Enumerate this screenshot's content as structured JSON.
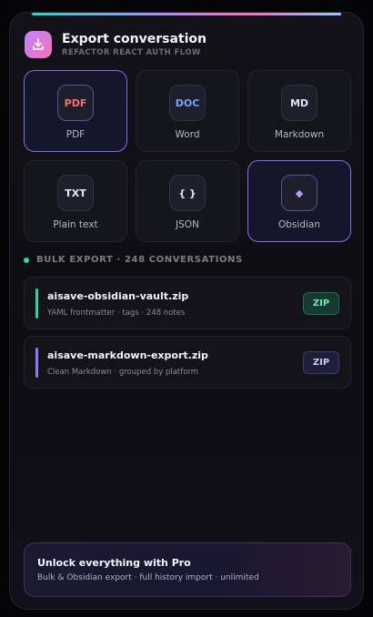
{
  "header": {
    "title": "Export conversation",
    "subtitle": "REFACTOR REACT AUTH FLOW",
    "icon": "download-icon"
  },
  "formats": [
    {
      "badge": "PDF",
      "label": "PDF",
      "color": "#f87171",
      "selected": true
    },
    {
      "badge": "DOC",
      "label": "Word",
      "color": "#7aa2ff",
      "selected": false
    },
    {
      "badge": "MD",
      "label": "Markdown",
      "color": "#e8e8f0",
      "selected": false
    },
    {
      "badge": "TXT",
      "label": "Plain text",
      "color": "#e8e8f0",
      "selected": false
    },
    {
      "badge": "{ }",
      "label": "JSON",
      "color": "#e8e8f0",
      "selected": false
    },
    {
      "badge": "◆",
      "label": "Obsidian",
      "color": "#b39dff",
      "selected": true
    }
  ],
  "bulk": {
    "section_label": "BULK EXPORT · 248 CONVERSATIONS",
    "items": [
      {
        "name": "aisave-obsidian-vault.zip",
        "desc": "YAML frontmatter · tags · 248 notes",
        "tag": "ZIP",
        "accent": "#34d399"
      },
      {
        "name": "aisave-markdown-export.zip",
        "desc": "Clean Markdown · grouped by platform",
        "tag": "ZIP",
        "accent": "#8b7cf6"
      }
    ]
  },
  "pro": {
    "title": "Unlock everything with Pro",
    "desc": "Bulk & Obsidian export · full history import · unlimited"
  }
}
